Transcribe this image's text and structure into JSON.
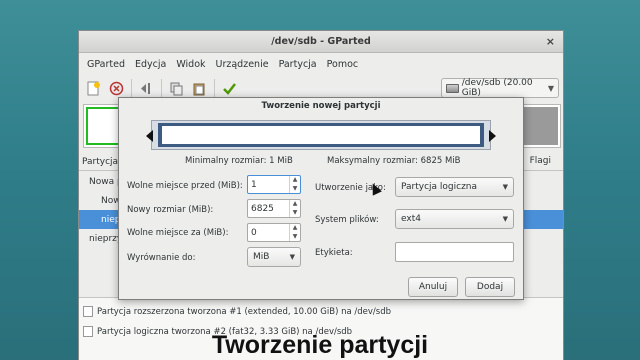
{
  "window": {
    "title": "/dev/sdb - GParted",
    "close_glyph": "×"
  },
  "menu": [
    "GParted",
    "Edycja",
    "Widok",
    "Urządzenie",
    "Partycja",
    "Pomoc"
  ],
  "toolbar": {
    "icons": [
      "new-icon",
      "delete-icon",
      "resize-icon",
      "copy-icon",
      "paste-icon",
      "apply-icon"
    ]
  },
  "device_selector": {
    "value": "/dev/sdb  (20.00 GiB)"
  },
  "table": {
    "header_partition": "Partycja",
    "header_flags": "Flagi",
    "rows": [
      {
        "label": "Nowa p"
      },
      {
        "label": "Now"
      },
      {
        "label": "niepi"
      },
      {
        "label": "nieprzy"
      }
    ]
  },
  "log": [
    "Partycja rozszerzona tworzona #1 (extended, 10.00 GiB) na /dev/sdb",
    "Partycja logiczna tworzona #2 (fat32, 3.33 GiB) na /dev/sdb"
  ],
  "dialog": {
    "title": "Tworzenie nowej partycji",
    "min_size": "Minimalny rozmiar: 1 MiB",
    "max_size": "Maksymalny rozmiar: 6825 MiB",
    "free_before_label": "Wolne miejsce przed (MiB):",
    "free_before_value": "1",
    "new_size_label": "Nowy rozmiar (MiB):",
    "new_size_value": "6825",
    "free_after_label": "Wolne miejsce za (MiB):",
    "free_after_value": "0",
    "align_label": "Wyrównanie do:",
    "align_value": "MiB",
    "create_as_label": "Utworzenie jako:",
    "create_as_value": "Partycja logiczna",
    "filesystem_label": "System plików:",
    "filesystem_value": "ext4",
    "tag_label": "Etykieta:",
    "tag_value": "",
    "cancel_label": "Anuluj",
    "add_label": "Dodaj"
  },
  "caption": "Tworzenie partycji",
  "colors": {
    "selection": "#4a90d9",
    "partition_outline": "#22bb22",
    "resizer_fill": "#3d5a80"
  }
}
